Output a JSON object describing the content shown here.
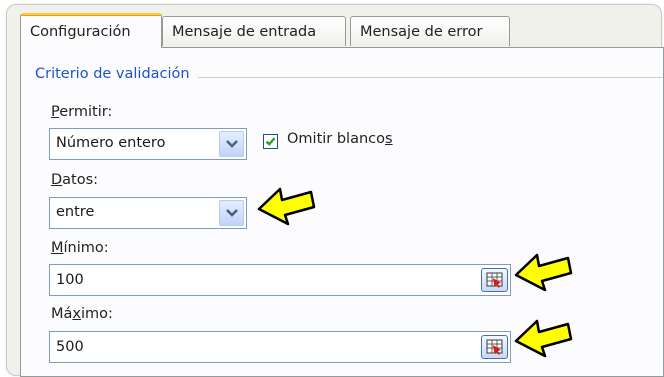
{
  "tabs": [
    {
      "label": "Configuración",
      "active": true
    },
    {
      "label": "Mensaje de entrada",
      "active": false
    },
    {
      "label": "Mensaje de error",
      "active": false
    }
  ],
  "group": {
    "title": "Criterio de validación"
  },
  "permitir": {
    "label_first": "P",
    "label_rest": "ermitir:",
    "value": "Número entero"
  },
  "omitir": {
    "label_main": "Omitir blanco",
    "label_access": "s",
    "checked": true
  },
  "datos": {
    "label_first": "D",
    "label_rest": "atos:",
    "value": "entre"
  },
  "minimo": {
    "label_first": "M",
    "label_rest": "ínimo:",
    "value": "100"
  },
  "maximo": {
    "label_start": "Má",
    "label_access": "x",
    "label_end": "imo:",
    "value": "500"
  },
  "icons": {
    "dropdown": "chevron-down-icon",
    "range_ref": "range-selector-icon",
    "callout": "arrow-left-icon",
    "check": "checkmark-icon"
  },
  "colors": {
    "group_title": "#1d52c8",
    "tab_highlight": "#ffc83c",
    "arrow_fill": "#ffff00",
    "checkmark": "#21a121"
  }
}
